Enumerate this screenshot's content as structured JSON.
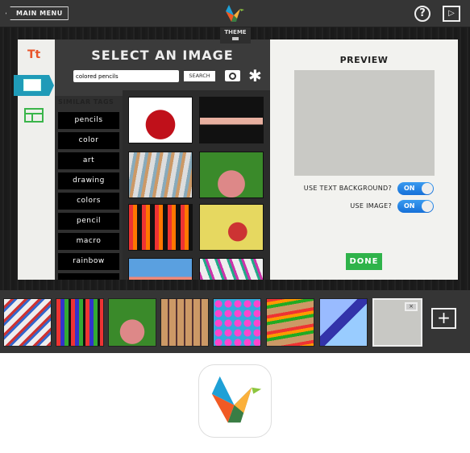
{
  "topbar": {
    "main_menu": "MAIN MENU",
    "help": "?",
    "play": "▷",
    "theme": "THEME",
    "logo": "haiku-deck-bird-logo"
  },
  "sidebar": {
    "text_tab": "Tt",
    "image_tab": "image-icon",
    "layout_tab": "layout-icon"
  },
  "select": {
    "title": "SELECT AN IMAGE",
    "search_value": "colored pencils",
    "search_button": "SEARCH",
    "camera": "camera-icon",
    "asterisk": "✱"
  },
  "tags": {
    "title": "SIMILAR TAGS",
    "items": [
      "pencils",
      "color",
      "art",
      "drawing",
      "colors",
      "pencil",
      "macro",
      "rainbow",
      ""
    ]
  },
  "preview": {
    "title": "PREVIEW",
    "opt_text_bg": "USE TEXT BACKGROUND?",
    "opt_text_bg_value": "ON",
    "opt_image": "USE IMAGE?",
    "opt_image_value": "ON",
    "done": "DONE"
  },
  "filmstrip": {
    "add": "+",
    "remove": "×"
  },
  "colors": {
    "accent_blue": "#1f9bb8",
    "done_green": "#2fb34a",
    "toggle_blue": "#1670d8",
    "text_orange": "#e8542a"
  }
}
